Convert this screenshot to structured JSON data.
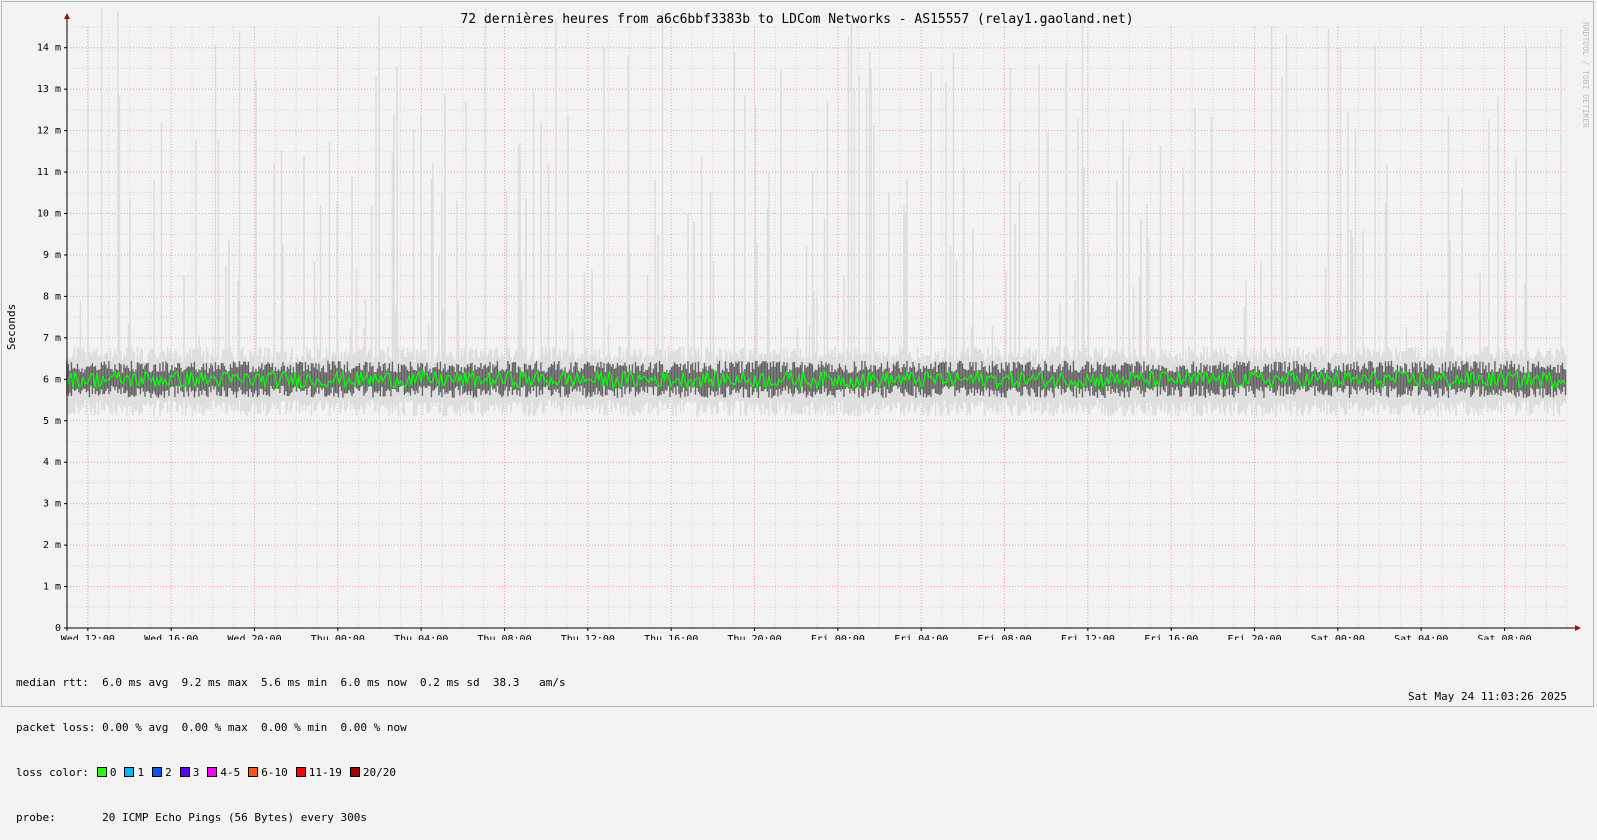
{
  "chart_data": {
    "type": "line",
    "title": "72 dernières heures from a6c6bbf3383b to LDCom Networks - AS15557 (relay1.gaoland.net)",
    "ylabel": "Seconds",
    "ylim": [
      0,
      0.0145
    ],
    "y_ticks": [
      {
        "value": 0,
        "label": "0"
      },
      {
        "value": 0.001,
        "label": "1 m"
      },
      {
        "value": 0.002,
        "label": "2 m"
      },
      {
        "value": 0.003,
        "label": "3 m"
      },
      {
        "value": 0.004,
        "label": "4 m"
      },
      {
        "value": 0.005,
        "label": "5 m"
      },
      {
        "value": 0.006,
        "label": "6 m"
      },
      {
        "value": 0.007,
        "label": "7 m"
      },
      {
        "value": 0.008,
        "label": "8 m"
      },
      {
        "value": 0.009,
        "label": "9 m"
      },
      {
        "value": 0.01,
        "label": "10 m"
      },
      {
        "value": 0.011,
        "label": "11 m"
      },
      {
        "value": 0.012,
        "label": "12 m"
      },
      {
        "value": 0.013,
        "label": "13 m"
      },
      {
        "value": 0.014,
        "label": "14 m"
      }
    ],
    "x_range_hours": [
      -1,
      71
    ],
    "x_ticks": [
      {
        "hours": 0,
        "label": "Wed 12:00"
      },
      {
        "hours": 4,
        "label": "Wed 16:00"
      },
      {
        "hours": 8,
        "label": "Wed 20:00"
      },
      {
        "hours": 12,
        "label": "Thu 00:00"
      },
      {
        "hours": 16,
        "label": "Thu 04:00"
      },
      {
        "hours": 20,
        "label": "Thu 08:00"
      },
      {
        "hours": 24,
        "label": "Thu 12:00"
      },
      {
        "hours": 28,
        "label": "Thu 16:00"
      },
      {
        "hours": 32,
        "label": "Thu 20:00"
      },
      {
        "hours": 36,
        "label": "Fri 00:00"
      },
      {
        "hours": 40,
        "label": "Fri 04:00"
      },
      {
        "hours": 44,
        "label": "Fri 08:00"
      },
      {
        "hours": 48,
        "label": "Fri 12:00"
      },
      {
        "hours": 52,
        "label": "Fri 16:00"
      },
      {
        "hours": 56,
        "label": "Fri 20:00"
      },
      {
        "hours": 60,
        "label": "Sat 00:00"
      },
      {
        "hours": 64,
        "label": "Sat 04:00"
      },
      {
        "hours": 68,
        "label": "Sat 08:00"
      }
    ],
    "median_rtt_s": 0.006,
    "grid": true,
    "colors": {
      "median": "#00ff00",
      "smoke_light": "#dddddd",
      "smoke_dark": "#3a3a3a",
      "grid_major": "#f0a0a0",
      "grid_minor": "#e6d0d0",
      "axis": "#000000",
      "arrow": "#a01010"
    }
  },
  "watermark": "RRDTOOL / TOBI OETIKER",
  "stats": {
    "median_rtt_line": "median rtt:  6.0 ms avg  9.2 ms max  5.6 ms min  6.0 ms now  0.2 ms sd  38.3   am/s",
    "packet_loss_line": "packet loss: 0.00 % avg  0.00 % max  0.00 % min  0.00 % now",
    "loss_color_label": "loss color:",
    "loss_colors": [
      {
        "label": "0",
        "color": "#26ff00"
      },
      {
        "label": "1",
        "color": "#00b8ff"
      },
      {
        "label": "2",
        "color": "#0059ff"
      },
      {
        "label": "3",
        "color": "#5e00ff"
      },
      {
        "label": "4-5",
        "color": "#ff00ff"
      },
      {
        "label": "6-10",
        "color": "#ff5500"
      },
      {
        "label": "11-19",
        "color": "#ff0000"
      },
      {
        "label": "20/20",
        "color": "#a10000"
      }
    ],
    "probe_label": "probe:",
    "probe_value": "20 ICMP Echo Pings (56 Bytes) every 300s",
    "date": "Sat May 24 11:03:26 2025"
  }
}
